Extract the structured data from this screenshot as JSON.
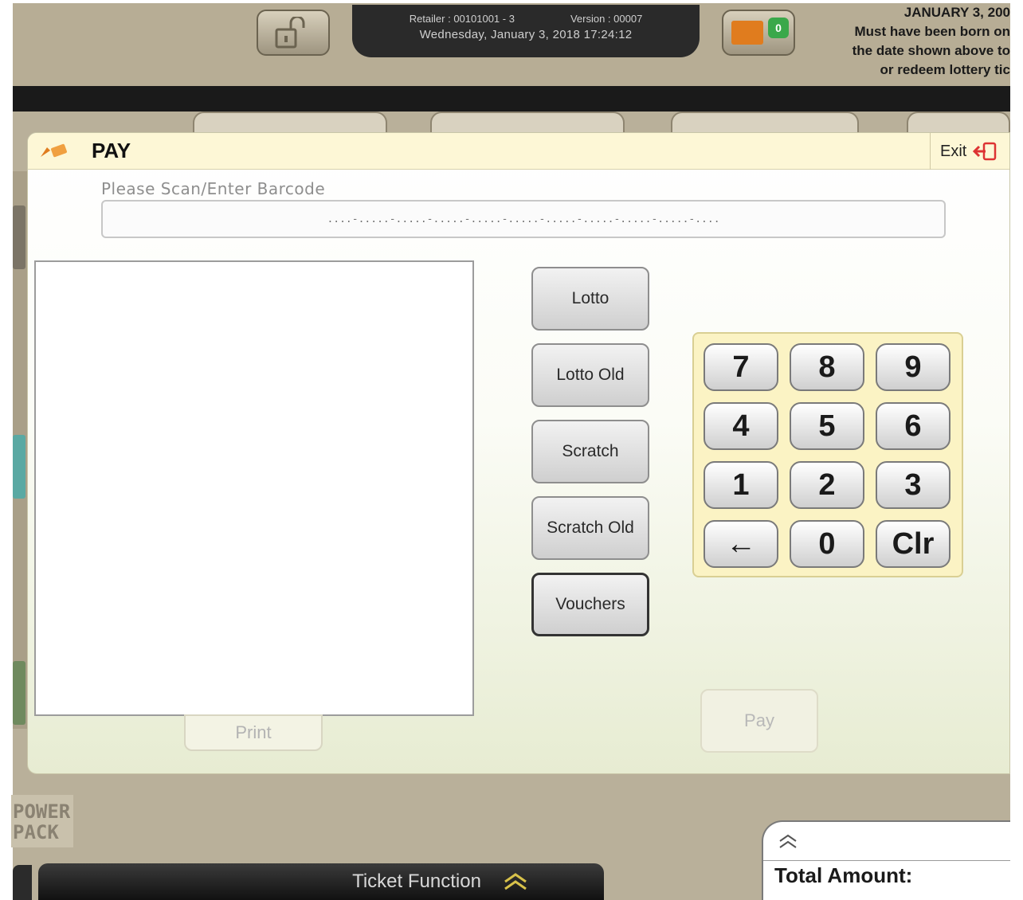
{
  "header": {
    "retailer_label": "Retailer : 00101001 - 3",
    "version_label": "Version : 00007",
    "datetime": "Wednesday, January 3, 2018 17:24:12",
    "message_count": "0",
    "age_notice": {
      "line1": "JANUARY 3, 200",
      "line2": "Must have been born on",
      "line3": "the date shown above to",
      "line4": "or redeem lottery tic"
    }
  },
  "dialog": {
    "title": "PAY",
    "exit_label": "Exit",
    "barcode_label": "Please Scan/Enter Barcode",
    "barcode_placeholder": "....-.....-.....-.....-.....-.....-.....-.....-.....-.....-....",
    "ticket_types": [
      "Lotto",
      "Lotto Old",
      "Scratch",
      "Scratch Old",
      "Vouchers"
    ],
    "selected_type": "Vouchers",
    "keypad": [
      "7",
      "8",
      "9",
      "4",
      "5",
      "6",
      "1",
      "2",
      "3",
      "←",
      "0",
      "Clr"
    ],
    "print_label": "Print",
    "pay_label": "Pay"
  },
  "footer": {
    "power_pack_line1": "POWER",
    "power_pack_line2": "PACK",
    "ticket_function_label": "Ticket Function",
    "total_amount_label": "Total Amount:"
  },
  "colors": {
    "header_bg": "#fdf7d6",
    "keypad_bg": "#fbf3c4",
    "app_bg": "#b9b09a",
    "accent_orange": "#e07c1e",
    "badge_green": "#3aa84a"
  }
}
